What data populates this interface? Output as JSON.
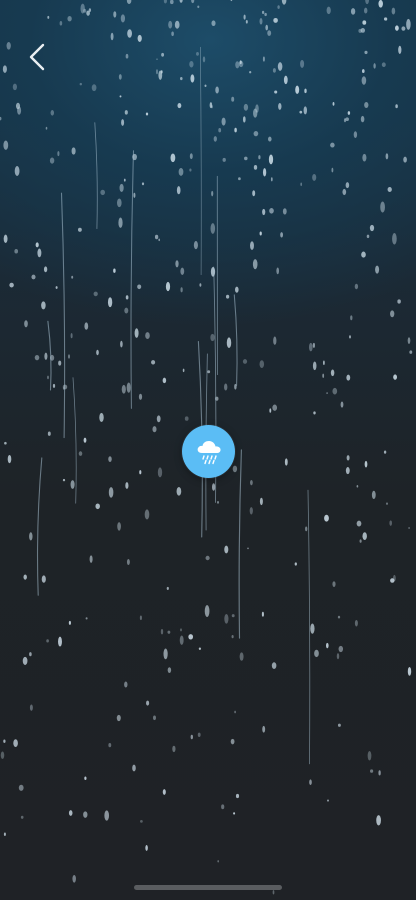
{
  "navigation": {
    "back_icon": "chevron-left-icon"
  },
  "player": {
    "sound_icon": "cloud-rain-icon",
    "accent_color": "#5bbdf5"
  },
  "background": {
    "scene": "rain-on-window",
    "top_color": "#163549",
    "bottom_color": "#1f2226"
  }
}
